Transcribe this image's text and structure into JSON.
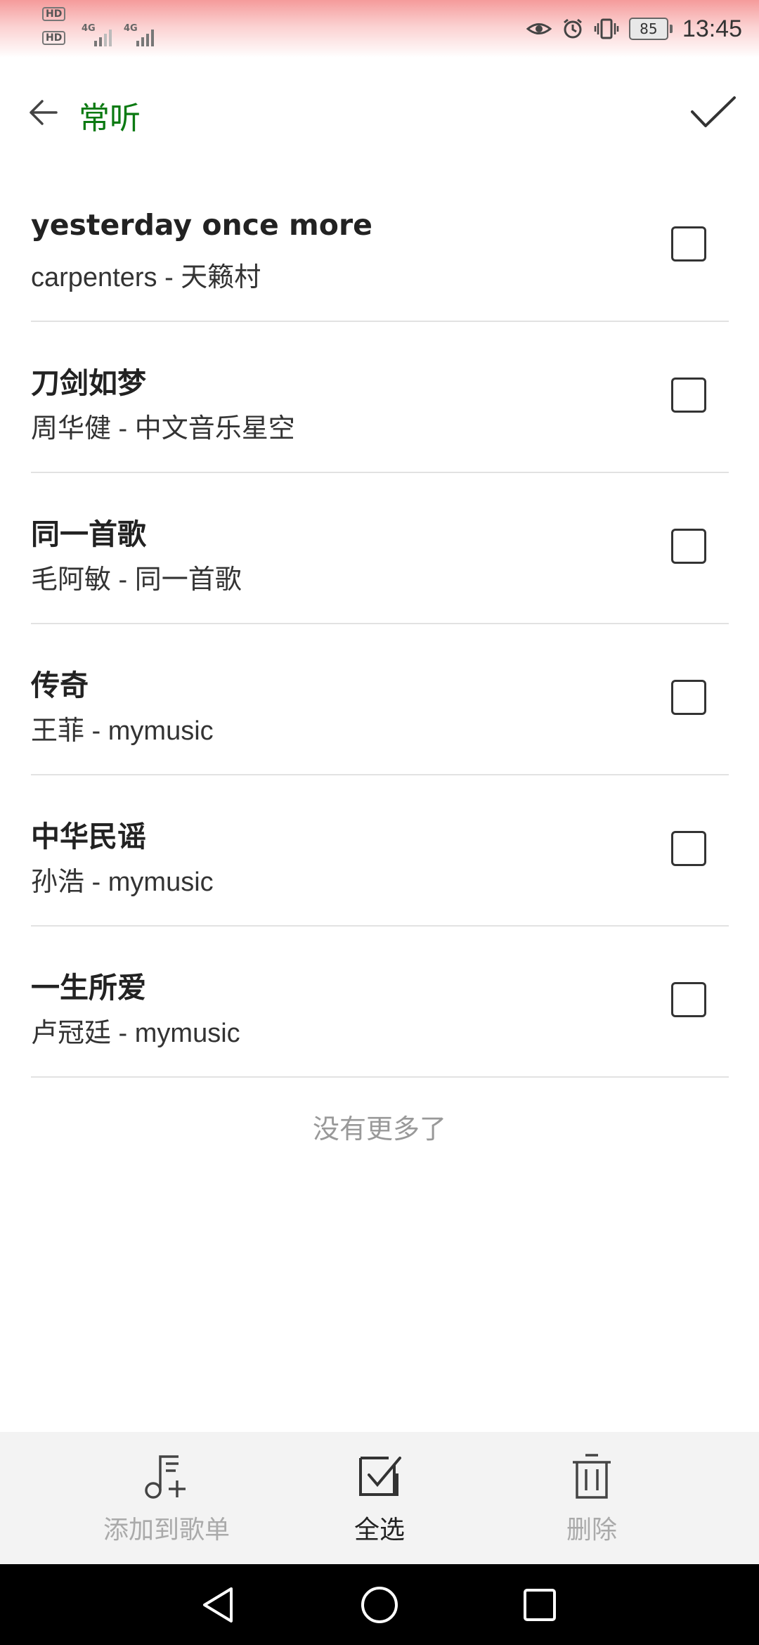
{
  "status_bar": {
    "hd1": "HD",
    "hd2": "HD",
    "net1": "4G",
    "net2": "4G",
    "battery": "85",
    "time": "13:45",
    "icons": [
      "eye-icon",
      "alarm-icon",
      "vibrate-icon",
      "battery-icon"
    ]
  },
  "header": {
    "title": "常听",
    "back_icon": "arrow-left-icon",
    "confirm_icon": "checkmark-icon"
  },
  "songs": [
    {
      "title": "yesterday once more",
      "subtitle": "carpenters - 天籁村"
    },
    {
      "title": "刀剑如梦",
      "subtitle": "周华健 - 中文音乐星空"
    },
    {
      "title": "同一首歌",
      "subtitle": "毛阿敏 - 同一首歌"
    },
    {
      "title": "传奇",
      "subtitle": "王菲 - mymusic"
    },
    {
      "title": "中华民谣",
      "subtitle": "孙浩 - mymusic"
    },
    {
      "title": "一生所爱",
      "subtitle": "卢冠廷 - mymusic"
    }
  ],
  "list_footer": "没有更多了",
  "toolbar": {
    "add_to_playlist": "添加到歌单",
    "select_all": "全选",
    "delete": "删除"
  },
  "colors": {
    "accent": "#0b7a12",
    "statusbar_top": "#f59b9b",
    "toolbar_bg": "#f3f3f3",
    "disabled_text": "#aaaaaa"
  }
}
